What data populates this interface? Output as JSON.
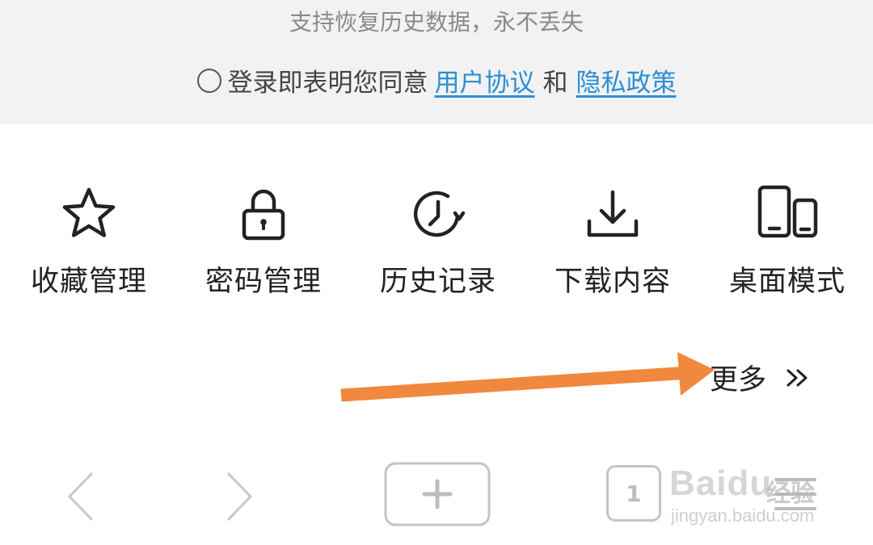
{
  "login_panel": {
    "backup_note": "支持恢复历史数据，永不丢失",
    "agreement_prefix": "登录即表明您同意",
    "user_agreement_link": "用户协议",
    "and_text": "和",
    "privacy_policy_link": "隐私政策"
  },
  "menu": {
    "items": [
      {
        "label": "收藏管理",
        "icon": "star-icon"
      },
      {
        "label": "密码管理",
        "icon": "lock-icon"
      },
      {
        "label": "历史记录",
        "icon": "history-clock-icon"
      },
      {
        "label": "下载内容",
        "icon": "download-icon"
      },
      {
        "label": "桌面模式",
        "icon": "desktop-mode-icon"
      }
    ],
    "more_label": "更多"
  },
  "annotation": {
    "arrow_color": "#f0883e"
  },
  "toolbar": {
    "tab_count": "1",
    "buttons": [
      "back-icon",
      "forward-icon",
      "add-tab-icon",
      "tab-count",
      "menu-icon"
    ]
  },
  "watermark": {
    "brand": "Baidu",
    "cn": "经验",
    "sub": "jingyan.baidu.com"
  },
  "colors": {
    "link": "#2b8fd6",
    "panel_bg": "#f2f2f2",
    "icon_stroke": "#222222",
    "toolbar_icon": "#bdbdbd"
  }
}
